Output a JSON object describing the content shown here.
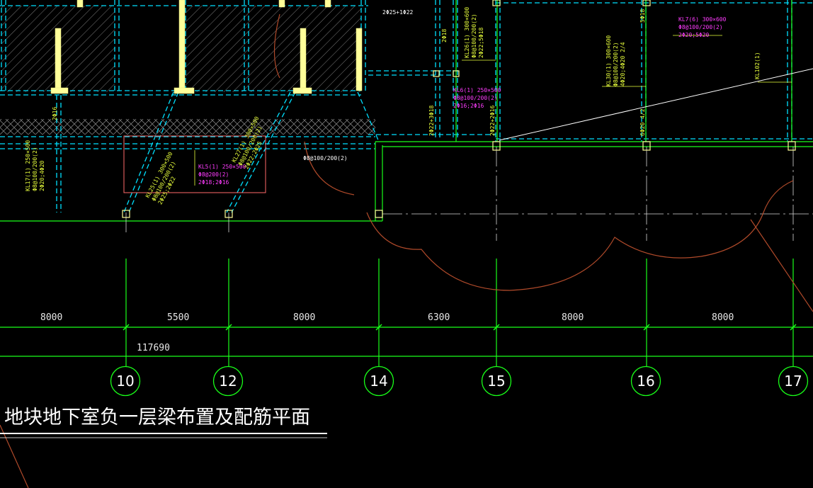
{
  "drawing": {
    "title": "地块地下室负一层梁布置及配筋平面",
    "total_dimension": "117690"
  },
  "dimensions": [
    "8000",
    "5500",
    "8000",
    "6300",
    "8000",
    "8000"
  ],
  "axes": [
    "10",
    "12",
    "14",
    "15",
    "16",
    "17"
  ],
  "beam_labels": {
    "kl5": [
      "KL5(1) 250×500",
      "Φ8@200(2)",
      "2Φ18;2Φ16"
    ],
    "kl25": [
      "KL25(1) 300×500",
      "Φ8@100/200(2)",
      "2Φ25;2Φ22"
    ],
    "kl27": [
      "KL27(1) 300×500",
      "Φ8@100/200(2)",
      "2Φ22;2Φ25"
    ],
    "kl17": [
      "KL17(1) 250×500",
      "Φ8@100/200(2)",
      "2Φ20;4Φ20"
    ],
    "kl6": [
      "KL6(1) 250×500",
      "Φ8@100/200(2)",
      "2Φ16;2Φ16"
    ],
    "kl26": [
      "KL26(1) 300×600",
      "Φ8@100/200(2)",
      "2Φ22;5Φ18"
    ],
    "kl7": [
      "KL7(6) 300×600",
      "Φ8@100/200(2)",
      "2Φ20;5Φ20"
    ],
    "kl30": [
      "KL30(1) 300×600",
      "Φ8@100/200(2)",
      "4Φ20;4Φ20 2/4"
    ],
    "kl102": [
      "KL102(1)"
    ],
    "stirrup_note": "Φ8@100/200(2)",
    "top_note": "2Φ25+1Φ22",
    "col_notes": [
      "2Φ18",
      "2Φ22+3Φ18",
      "6Φ20 4/2",
      "5Φ18",
      "2Φ22+2Φ16",
      "2Φ16"
    ]
  },
  "colors": {
    "background": "#000000",
    "grid": "#19ff19",
    "beam": "#00e0ff",
    "wall": "#ffff99",
    "leader": "#ff3cff",
    "arc": "#b04a2a"
  }
}
